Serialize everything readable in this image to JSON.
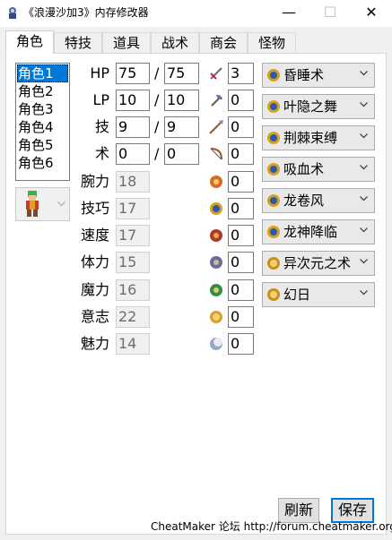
{
  "window": {
    "title": "《浪漫沙加3》内存修改器",
    "min_label": "—",
    "max_label": "☐",
    "close_label": "✕"
  },
  "tabs": [
    {
      "label": "角色",
      "active": true
    },
    {
      "label": "特技"
    },
    {
      "label": "道具"
    },
    {
      "label": "战术"
    },
    {
      "label": "商会"
    },
    {
      "label": "怪物"
    }
  ],
  "character_list": [
    "角色1",
    "角色2",
    "角色3",
    "角色4",
    "角色5",
    "角色6"
  ],
  "selected_character": "角色1",
  "stats": {
    "hp": {
      "label": "HP",
      "current": "75",
      "max": "75"
    },
    "lp": {
      "label": "LP",
      "current": "10",
      "max": "10"
    },
    "waza": {
      "label": "技",
      "current": "9",
      "max": "9"
    },
    "jutsu": {
      "label": "术",
      "current": "0",
      "max": "0"
    },
    "slash": "/",
    "attributes": [
      {
        "label": "腕力",
        "value": "18"
      },
      {
        "label": "技巧",
        "value": "17"
      },
      {
        "label": "速度",
        "value": "17"
      },
      {
        "label": "体力",
        "value": "15"
      },
      {
        "label": "魔力",
        "value": "16"
      },
      {
        "label": "意志",
        "value": "22"
      },
      {
        "label": "魅力",
        "value": "14"
      }
    ]
  },
  "weapon_skills": [
    {
      "icon": "sword-icon",
      "value": "3"
    },
    {
      "icon": "axe-icon",
      "value": "0"
    },
    {
      "icon": "spear-icon",
      "value": "0"
    },
    {
      "icon": "bow-icon",
      "value": "0"
    },
    {
      "icon": "fire-magic-icon",
      "value": "0"
    },
    {
      "icon": "water-magic-icon",
      "value": "0"
    },
    {
      "icon": "wind-magic-icon",
      "value": "0"
    },
    {
      "icon": "earth-magic-icon",
      "value": "0"
    },
    {
      "icon": "sky-magic-icon",
      "value": "0"
    },
    {
      "icon": "sun-magic-icon",
      "value": "0"
    },
    {
      "icon": "moon-magic-icon",
      "value": "0"
    }
  ],
  "spells": [
    {
      "label": "昏睡术",
      "icon": "water-spell-icon"
    },
    {
      "label": "叶隐之舞",
      "icon": "water-spell-icon"
    },
    {
      "label": "荆棘束缚",
      "icon": "water-spell-icon"
    },
    {
      "label": "吸血术",
      "icon": "water-spell-icon"
    },
    {
      "label": "龙卷风",
      "icon": "water-spell-icon"
    },
    {
      "label": "龙神降临",
      "icon": "water-spell-icon"
    },
    {
      "label": "异次元之术",
      "icon": "sun-spell-icon"
    },
    {
      "label": "幻日",
      "icon": "sun-spell-icon"
    }
  ],
  "buttons": {
    "refresh": "刷新",
    "save": "保存"
  },
  "footer": "CheatMaker 论坛  http://forum.cheatmaker.org/"
}
